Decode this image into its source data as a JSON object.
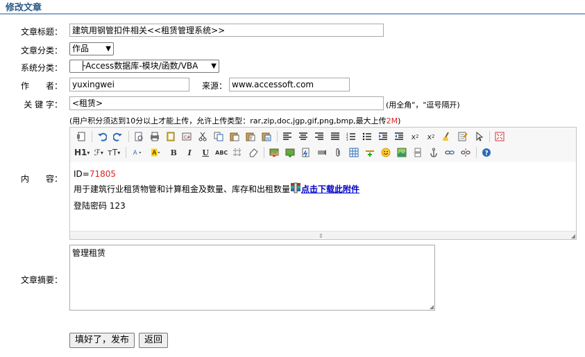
{
  "page_title": "修改文章",
  "form": {
    "title_label": "文章标题：",
    "title_value": "建筑用钢管扣件相关<<租赁管理系统>>",
    "category_label": "文章分类：",
    "category_value": "作品",
    "system_label": "系统分类：",
    "system_value": "├Access数据库-模块/函数/VBA",
    "author_label": "作　　者：",
    "author_value": "yuxingwei",
    "source_label": "来源：",
    "source_value": "www.accessoft.com",
    "keyword_label": "关 键 字：",
    "keyword_value": "<租赁>",
    "keyword_hint": "(用全角\"，\"逗号隔开)",
    "upload_hint_prefix": "(用户积分须达到10分以上才能上传，允许上传类型：rar,zip,doc,jgp,gif,png,bmp,最大上传",
    "upload_hint_size": "2M",
    "upload_hint_suffix": ")",
    "content_label": "内　　容：",
    "summary_label": "文章摘要：",
    "summary_value": "管理租赁"
  },
  "editor": {
    "heading_btn": "H1",
    "font_btn": "ℱ",
    "size_btn": "тT",
    "id_prefix": "ID=",
    "id_value": "71805",
    "line2_text": "用于建筑行业租赁物管和计算租金及数量、库存和出租数量",
    "download_link": "点击下载此附件",
    "line3_text": "登陆密码 123"
  },
  "buttons": {
    "submit": "填好了，发布",
    "back": "返回"
  },
  "colors": {
    "title": "#2a5a8a",
    "title_line": "#8aa8c8",
    "red": "#dd2222",
    "link": "#0000cc"
  }
}
